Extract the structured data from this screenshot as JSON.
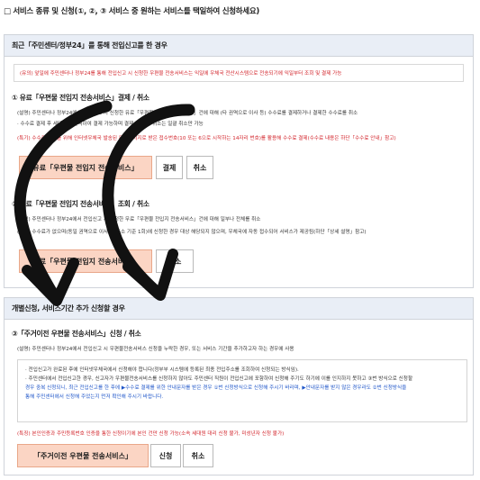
{
  "header": {
    "title": "□ 서비스 종류 및 신청(①, ②, ③ 서비스 중 원하는 서비스를 택일하여 신청하세요)"
  },
  "panel1": {
    "heading": "최근「주민센터/정부24」를 통해 전입신고를 한 경우",
    "notice": "(유의) 앞일에 주민센터나 정부24를 통해 전입신고 시 신청한 우편물 전송서비스는 익일에 우체국 전산시스템으로 전송되기에 익일부터 조회 및 결제 가능",
    "sec1": {
      "title": "① 유료「우편물 전입지 전송서비스」결제 / 취소",
      "line1": "(설명) 주민센터나 정부24에서 전입신고 시 신청한 유료「우편물 전입지 전송서비스」건에 대해 (타 권역으로 이사 등) 수수료를 결제하거나 결제한 수수료를 취소",
      "line2": "· 수수료 결제 후 세대원만 선택하여 결제 가능하며 결제 완료 건 취소는 일괄 취소만 가능",
      "line3": "(특기) 수수료 결제를 위해 인터넷우체국 발송된 문자메시지로 받은 접수번호(10 또는 6으로 시작하는 14자리 번호)를 활용해 수수료 결제(수수료 내용은 하단「수수료 안내」참고)",
      "pay_label": "유료「우편물 전입지 전송서비스」",
      "confirm_label": "결제",
      "cancel_label": "취소"
    },
    "sec2": {
      "title": "② 무료「우편물 전입지 전송서비스」조회 / 취소",
      "line1": "(설명) 주민센터나 정부24에서 전입신고 시 신청한 무료「우편물 전입지 전송서비스」건에 대해 일부나 전체를 취소",
      "line2": "(유의) 수수료가 없으며(동일 권역으로 이사 시 주소 기준 1회)에 신청한 경우 대상 해당되지 않으며, 우체국에 자동 접수되어 서비스가 제공됨(하단「상세 설명」참고)",
      "free_label": "무료「우편물 전입지 전송서비스」",
      "cancel_label": "취소"
    }
  },
  "panel2": {
    "heading": "개별신청, 서비스기간 추가 신청할 경우",
    "sec3": {
      "title": "③「주거이전 우편물 전송서비스」신청 / 취소",
      "line1": "(설명) 주민센터나 정부24에서 전입신고 시 우편물전송서비스 신청을 누락한 경우, 또는 서비스 기간을 추가하고자 하는 경우에 사용",
      "box1": "· 전입신고가 완료된 후에 인터넷우체국에서 신청해야 합니다(정부부 시스템에 등록된 최종 전입주소를 조회하여 신청되는 방식임).",
      "box2": "· 주민센터에서 전입신고한 경우, 신고자가 우편물전송서비스를 신청하지 않아도 주민센터 직원이 전입신고에 포함하여 신청해 주기도 하기에 이를 인지하지 못하고 ③번 방식으로 신청할",
      "box3": "경우 중복 신청되니, 최근 전입신고를 한 후에 ▶수수료 결제를 위한 안내문자를 받은 경우 ①번 신청방식으로 신청해 주시기 바라며, ▶안내문자를 받지 않은 경우라도 ②번 신청방식을",
      "box4": "통해 주민센터에서 신청해 주었는지 먼저 확인해 주시기 바랍니다.",
      "line2": "(특징) 본인인증과 주민등록번호 인증을 통한 신청이기에 본인 건만 신청 가능(소속 세대원 대리 신청 불가, 미성년자 신청 불가)",
      "main_label": "「주거이전 우편물 전송서비스」",
      "apply_label": "신청",
      "cancel_label": "취소"
    }
  },
  "colors": {
    "accent_btn": "#fbd5c4",
    "notice_red": "#d2232a",
    "header_bg": "#e9eef6"
  }
}
